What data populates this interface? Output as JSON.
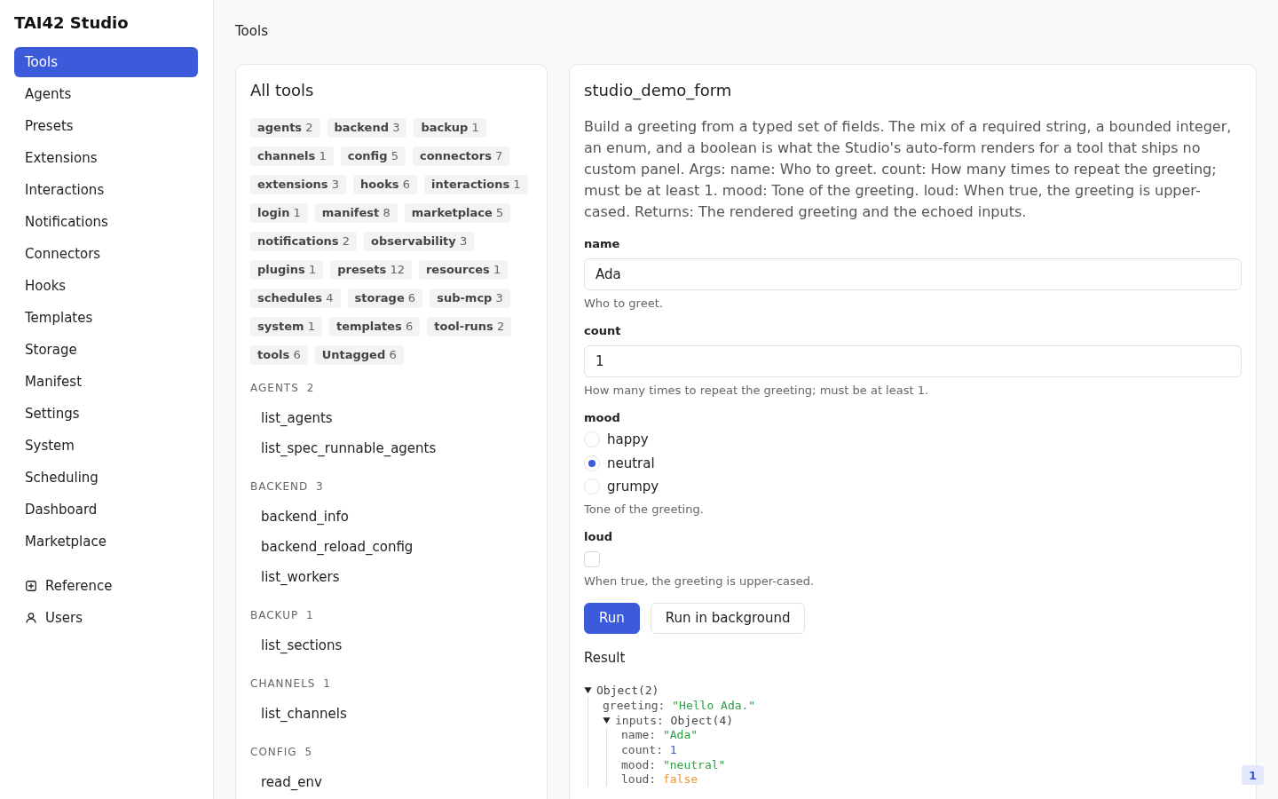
{
  "app": {
    "title": "TAI42 Studio"
  },
  "sidebar": {
    "items": [
      {
        "label": "Tools",
        "selected": true
      },
      {
        "label": "Agents",
        "selected": false
      },
      {
        "label": "Presets",
        "selected": false
      },
      {
        "label": "Extensions",
        "selected": false
      },
      {
        "label": "Interactions",
        "selected": false
      },
      {
        "label": "Notifications",
        "selected": false
      },
      {
        "label": "Connectors",
        "selected": false
      },
      {
        "label": "Hooks",
        "selected": false
      },
      {
        "label": "Templates",
        "selected": false
      },
      {
        "label": "Storage",
        "selected": false
      },
      {
        "label": "Manifest",
        "selected": false
      },
      {
        "label": "Settings",
        "selected": false
      },
      {
        "label": "System",
        "selected": false
      },
      {
        "label": "Scheduling",
        "selected": false
      },
      {
        "label": "Dashboard",
        "selected": false
      },
      {
        "label": "Marketplace",
        "selected": false
      }
    ],
    "footer_items": [
      {
        "label": "Reference"
      },
      {
        "label": "Users"
      }
    ]
  },
  "breadcrumb": "Tools",
  "tools_panel": {
    "title": "All tools",
    "tags": [
      {
        "name": "agents",
        "count": "2"
      },
      {
        "name": "backend",
        "count": "3"
      },
      {
        "name": "backup",
        "count": "1"
      },
      {
        "name": "channels",
        "count": "1"
      },
      {
        "name": "config",
        "count": "5"
      },
      {
        "name": "connectors",
        "count": "7"
      },
      {
        "name": "extensions",
        "count": "3"
      },
      {
        "name": "hooks",
        "count": "6"
      },
      {
        "name": "interactions",
        "count": "1"
      },
      {
        "name": "login",
        "count": "1"
      },
      {
        "name": "manifest",
        "count": "8"
      },
      {
        "name": "marketplace",
        "count": "5"
      },
      {
        "name": "notifications",
        "count": "2"
      },
      {
        "name": "observability",
        "count": "3"
      },
      {
        "name": "plugins",
        "count": "1"
      },
      {
        "name": "presets",
        "count": "12"
      },
      {
        "name": "resources",
        "count": "1"
      },
      {
        "name": "schedules",
        "count": "4"
      },
      {
        "name": "storage",
        "count": "6"
      },
      {
        "name": "sub-mcp",
        "count": "3"
      },
      {
        "name": "system",
        "count": "1"
      },
      {
        "name": "templates",
        "count": "6"
      },
      {
        "name": "tool-runs",
        "count": "2"
      },
      {
        "name": "tools",
        "count": "6"
      },
      {
        "name": "Untagged",
        "count": "6"
      }
    ],
    "groups": [
      {
        "name": "AGENTS",
        "count": "2",
        "tools": [
          "list_agents",
          "list_spec_runnable_agents"
        ]
      },
      {
        "name": "BACKEND",
        "count": "3",
        "tools": [
          "backend_info",
          "backend_reload_config",
          "list_workers"
        ]
      },
      {
        "name": "BACKUP",
        "count": "1",
        "tools": [
          "list_sections"
        ]
      },
      {
        "name": "CHANNELS",
        "count": "1",
        "tools": [
          "list_channels"
        ]
      },
      {
        "name": "CONFIG",
        "count": "5",
        "tools": [
          "read_env"
        ]
      }
    ]
  },
  "tool_form": {
    "title": "studio_demo_form",
    "description": "Build a greeting from a typed set of fields. The mix of a required string, a bounded integer, an enum, and a boolean is what the Studio's auto-form renders for a tool that ships no custom panel. Args: name: Who to greet. count: How many times to repeat the greeting; must be at least 1. mood: Tone of the greeting. loud: When true, the greeting is upper-cased. Returns: The rendered greeting and the echoed inputs.",
    "fields": [
      {
        "kind": "text",
        "label": "name",
        "value": "Ada",
        "help": "Who to greet."
      },
      {
        "kind": "number",
        "label": "count",
        "value": "1",
        "help": "How many times to repeat the greeting; must be at least 1."
      },
      {
        "kind": "radio",
        "label": "mood",
        "options": [
          {
            "label": "happy",
            "selected": false
          },
          {
            "label": "neutral",
            "selected": true
          },
          {
            "label": "grumpy",
            "selected": false
          }
        ],
        "help": "Tone of the greeting."
      },
      {
        "kind": "checkbox",
        "label": "loud",
        "checked": false,
        "help": "When true, the greeting is upper-cased."
      }
    ],
    "buttons": [
      {
        "label": "Run",
        "kind": "primary"
      },
      {
        "label": "Run in background",
        "kind": "secondary"
      }
    ],
    "result": {
      "title": "Result",
      "tree": {
        "kind": "object",
        "value": "Object(2)",
        "expanded": true,
        "children": [
          {
            "kind": "string",
            "key": "greeting:",
            "value": "\"Hello Ada.\""
          },
          {
            "kind": "object",
            "key": "inputs:",
            "value": "Object(4)",
            "expanded": true,
            "children": [
              {
                "kind": "string",
                "key": "name:",
                "value": "\"Ada\""
              },
              {
                "kind": "number",
                "key": "count:",
                "value": "1"
              },
              {
                "kind": "string",
                "key": "mood:",
                "value": "\"neutral\""
              },
              {
                "kind": "boolean",
                "key": "loud:",
                "value": "false"
              }
            ]
          }
        ]
      }
    }
  },
  "badge": "1"
}
